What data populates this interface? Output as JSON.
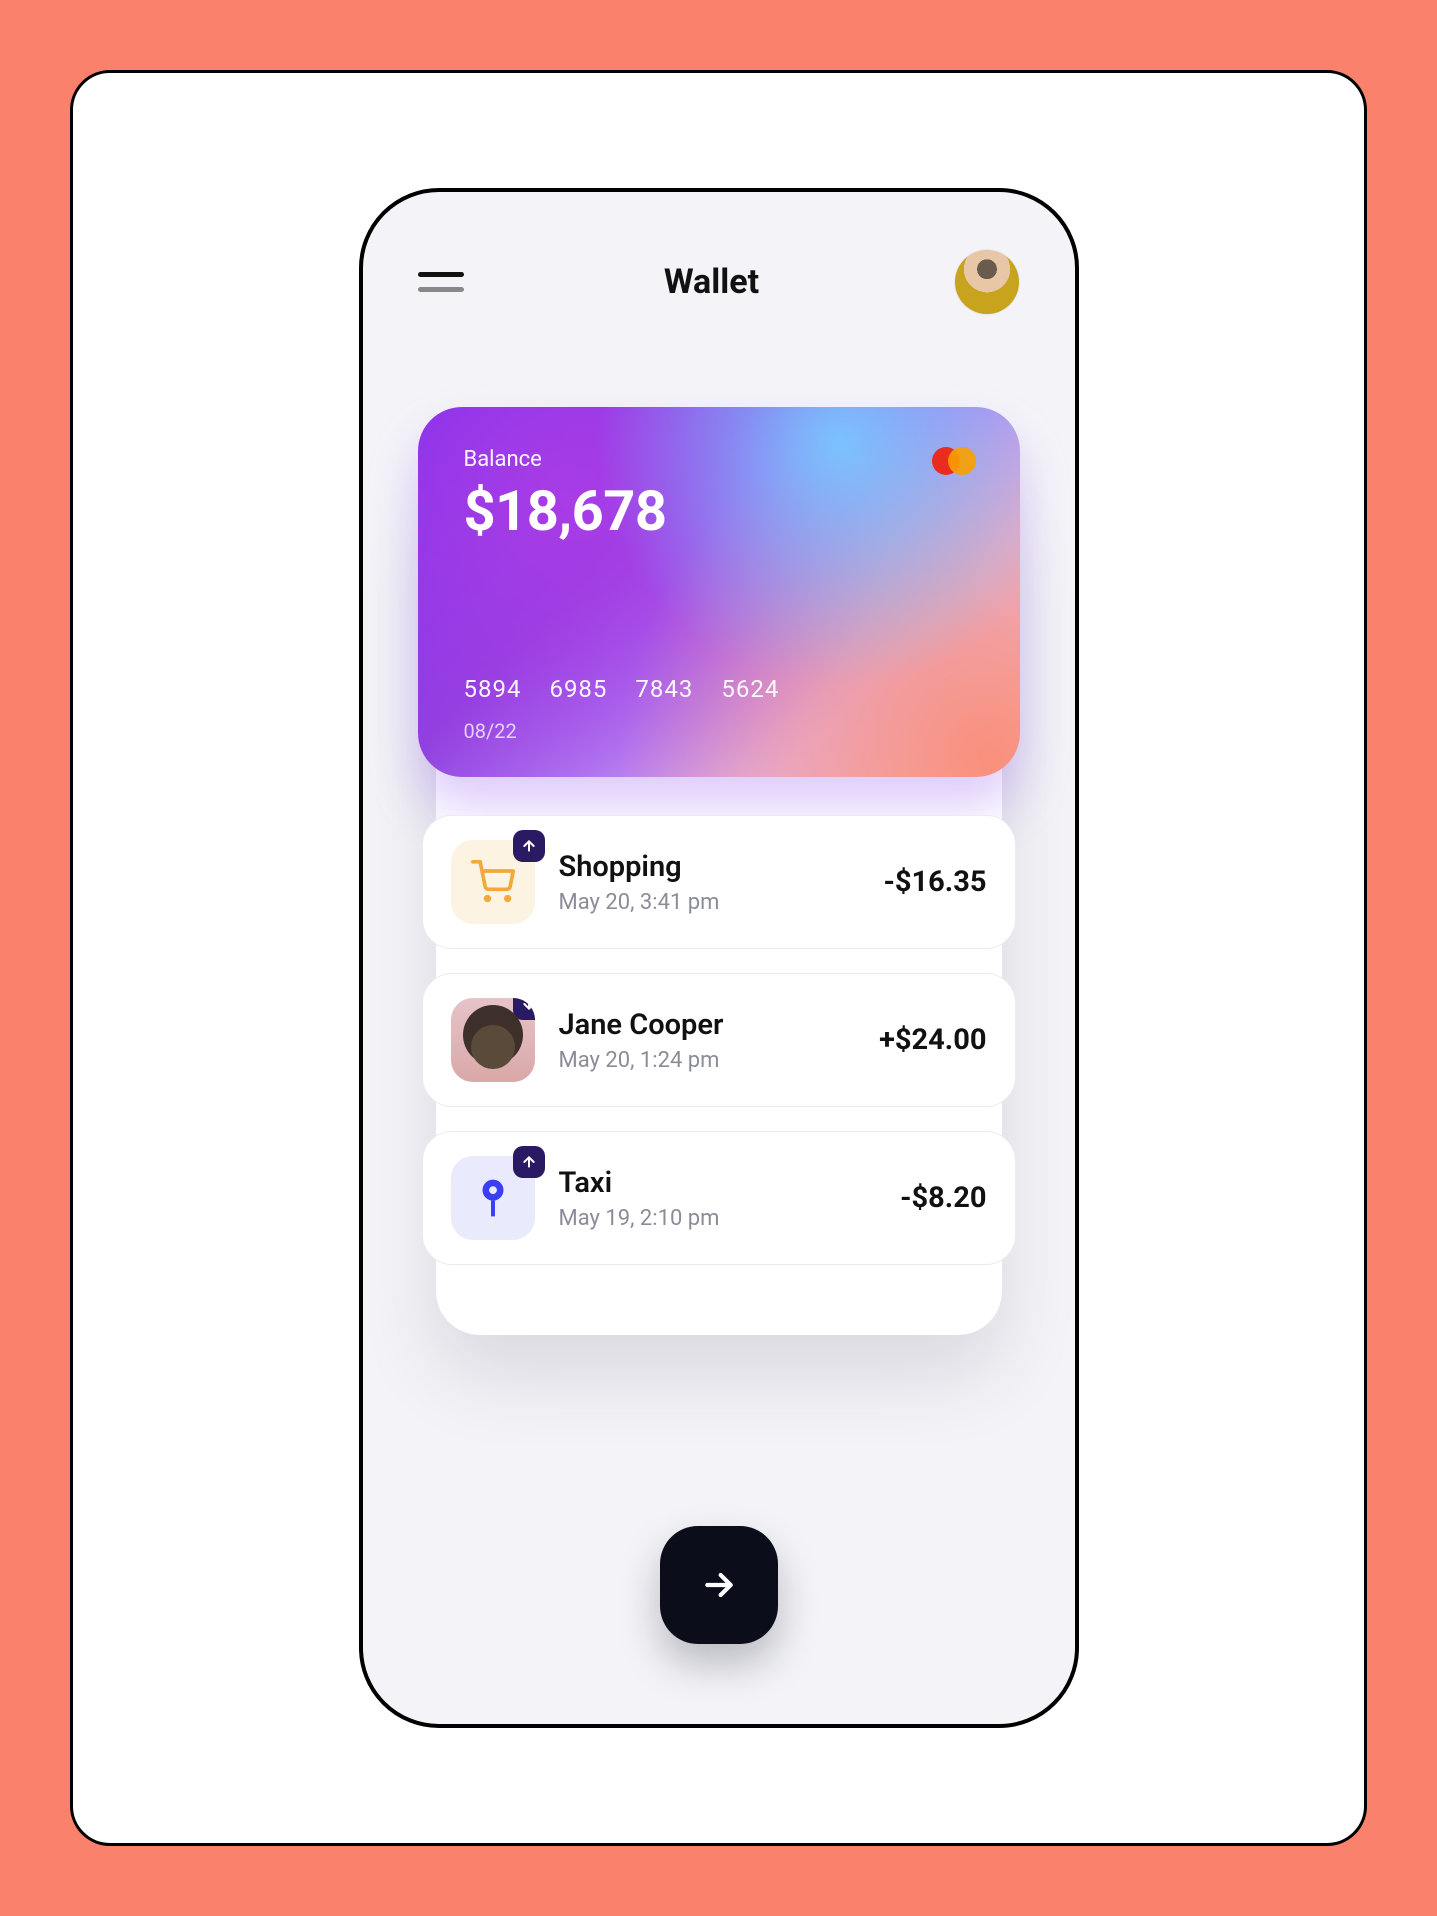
{
  "header": {
    "title": "Wallet"
  },
  "card": {
    "balance_label": "Balance",
    "balance_amount": "$18,678",
    "number_groups": [
      "5894",
      "6985",
      "7843",
      "5624"
    ],
    "expiry": "08/22"
  },
  "transactions": [
    {
      "icon": "cart",
      "direction": "out",
      "title": "Shopping",
      "subtitle": "May 20, 3:41 pm",
      "amount": "-$16.35"
    },
    {
      "icon": "person",
      "direction": "in",
      "title": "Jane Cooper",
      "subtitle": "May 20, 1:24 pm",
      "amount": "+$24.00"
    },
    {
      "icon": "pin",
      "direction": "out",
      "title": "Taxi",
      "subtitle": "May 19, 2:10 pm",
      "amount": "-$8.20"
    }
  ]
}
